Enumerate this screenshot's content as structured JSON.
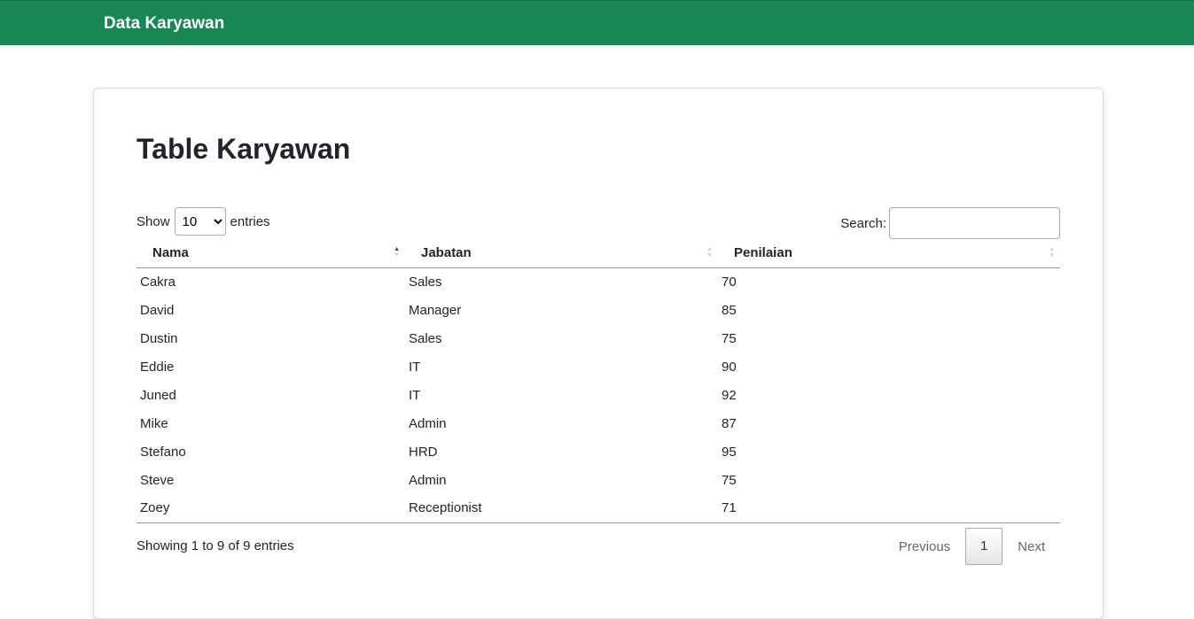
{
  "navbar": {
    "brand": "Data Karyawan"
  },
  "page": {
    "title": "Table Karyawan"
  },
  "length_control": {
    "prefix": "Show",
    "selected": "10",
    "suffix": "entries",
    "options": [
      "10"
    ]
  },
  "search": {
    "label": "Search:",
    "value": "",
    "placeholder": ""
  },
  "table": {
    "columns": [
      "Nama",
      "Jabatan",
      "Penilaian"
    ],
    "rows": [
      [
        "Cakra",
        "Sales",
        "70"
      ],
      [
        "David",
        "Manager",
        "85"
      ],
      [
        "Dustin",
        "Sales",
        "75"
      ],
      [
        "Eddie",
        "IT",
        "90"
      ],
      [
        "Juned",
        "IT",
        "92"
      ],
      [
        "Mike",
        "Admin",
        "87"
      ],
      [
        "Stefano",
        "HRD",
        "95"
      ],
      [
        "Steve",
        "Admin",
        "75"
      ],
      [
        "Zoey",
        "Receptionist",
        "71"
      ]
    ]
  },
  "info": "Showing 1 to 9 of 9 entries",
  "pagination": {
    "previous": "Previous",
    "current": "1",
    "next": "Next"
  },
  "colors": {
    "navbar": "#198754",
    "brand_text": "#ffffff"
  }
}
